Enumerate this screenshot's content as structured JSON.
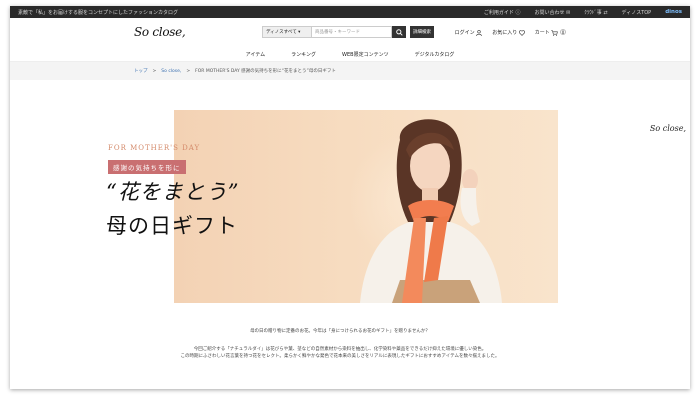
{
  "topbar": {
    "promo": "素敵で「私」をお届けする服をコンセプトにしたファッションカタログ",
    "links": [
      "ご利用ガイド ⓘ",
      "お問い合わせ ✉",
      "ｸﾗｳﾄﾞ事 ⇄",
      "ディノスTOP"
    ],
    "dinos": "dinos"
  },
  "header": {
    "logo": "So close,",
    "search_category": "ディノスすべて ▾",
    "search_placeholder": "商品番号・キーワード",
    "search_icon": "search-icon",
    "detail_search": "詳細検索",
    "login": "ログイン",
    "favorites": "お気に入り",
    "cart": "カート",
    "cart_count": "0"
  },
  "nav": [
    "アイテム",
    "ランキング",
    "WEB限定コンテンツ",
    "デジタルカタログ"
  ],
  "breadcrumb": [
    "トップ",
    "So close,",
    "FOR MOTHER'S DAY 感謝の気持ちを形に“花をまとう”母の日ギフト"
  ],
  "hero": {
    "subtitle": "FOR MOTHER'S DAY",
    "tag": "感謝の気持ちを形に",
    "title_line1": "“花をまとう”",
    "title_line2": "母の日ギフト",
    "side_logo": "So close,"
  },
  "intro": {
    "line1": "母の日の贈り物に定番のお花。今年は「身につけられるお花のギフト」を贈りませんか？",
    "line2": "今回ご紹介する「ナチュラルダイ」は花びらや葉、茎などの自然素材から染料を抽出し、化学染料や薬品をできるだけ抑えた環境に優しい染色。",
    "line3": "この時期にふさわしい花言葉を持つ花をセレクト。柔らかく鮮やかな発色で花本来の美しさをリアルに表現したギフトにおすすめアイテムを数々揃えました。"
  },
  "colors": {
    "accent_tag": "#c96f71",
    "hero_bg": "#f3d2b4",
    "subtitle": "#d48a6a"
  }
}
